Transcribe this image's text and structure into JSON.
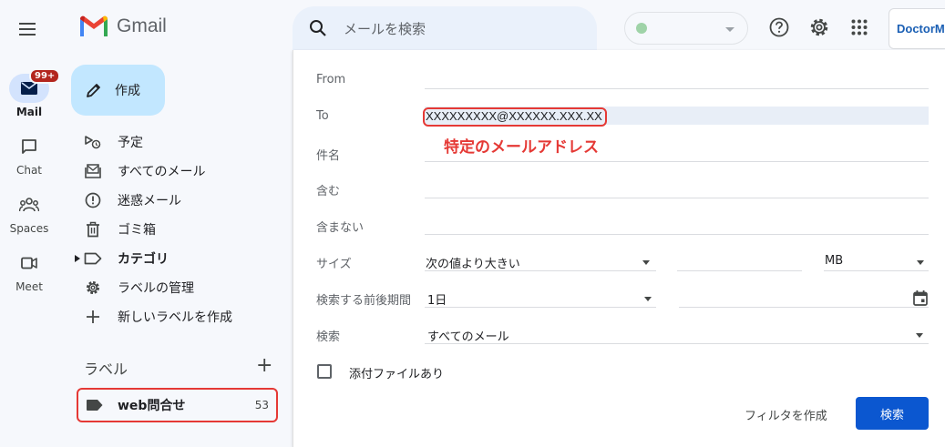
{
  "app": {
    "name": "Gmail"
  },
  "rail": [
    {
      "label": "Mail",
      "badge": "99+",
      "icon": "mail-icon"
    },
    {
      "label": "Chat",
      "icon": "chat-icon"
    },
    {
      "label": "Spaces",
      "icon": "spaces-icon"
    },
    {
      "label": "Meet",
      "icon": "meet-icon"
    }
  ],
  "compose": {
    "label": "作成"
  },
  "nav": [
    {
      "label": "予定",
      "icon": "scheduled-icon"
    },
    {
      "label": "すべてのメール",
      "icon": "all-mail-icon"
    },
    {
      "label": "迷惑メール",
      "icon": "spam-icon"
    },
    {
      "label": "ゴミ箱",
      "icon": "trash-icon"
    },
    {
      "label": "カテゴリ",
      "icon": "category-icon"
    },
    {
      "label": "ラベルの管理",
      "icon": "gear-icon"
    },
    {
      "label": "新しいラベルを作成",
      "icon": "plus-icon"
    }
  ],
  "labels": {
    "heading": "ラベル",
    "add": "+",
    "items": [
      {
        "label": "web問合せ",
        "count": "53"
      }
    ]
  },
  "search": {
    "placeholder": "メールを検索"
  },
  "account": {
    "name": "DoctorM"
  },
  "panel": {
    "from_label": "From",
    "to_label": "To",
    "to_value": "XXXXXXXXX@XXXXXX.XXX.XX",
    "annotation": "特定のメールアドレス",
    "subject_label": "件名",
    "has_label": "含む",
    "doesnt_have_label": "含まない",
    "size_label": "サイズ",
    "size_operator": "次の値より大きい",
    "size_unit": "MB",
    "date_within_label": "検索する前後期間",
    "date_within_value": "1日",
    "search_in_label": "検索",
    "search_in_value": "すべてのメール",
    "attachment_label": "添付ファイルあり",
    "create_filter": "フィルタを作成",
    "search_button": "検索"
  },
  "colors": {
    "accent": "#0b57d0",
    "compose_bg": "#c2e7ff",
    "annotation": "#e53935",
    "badge": "#b3261e"
  }
}
